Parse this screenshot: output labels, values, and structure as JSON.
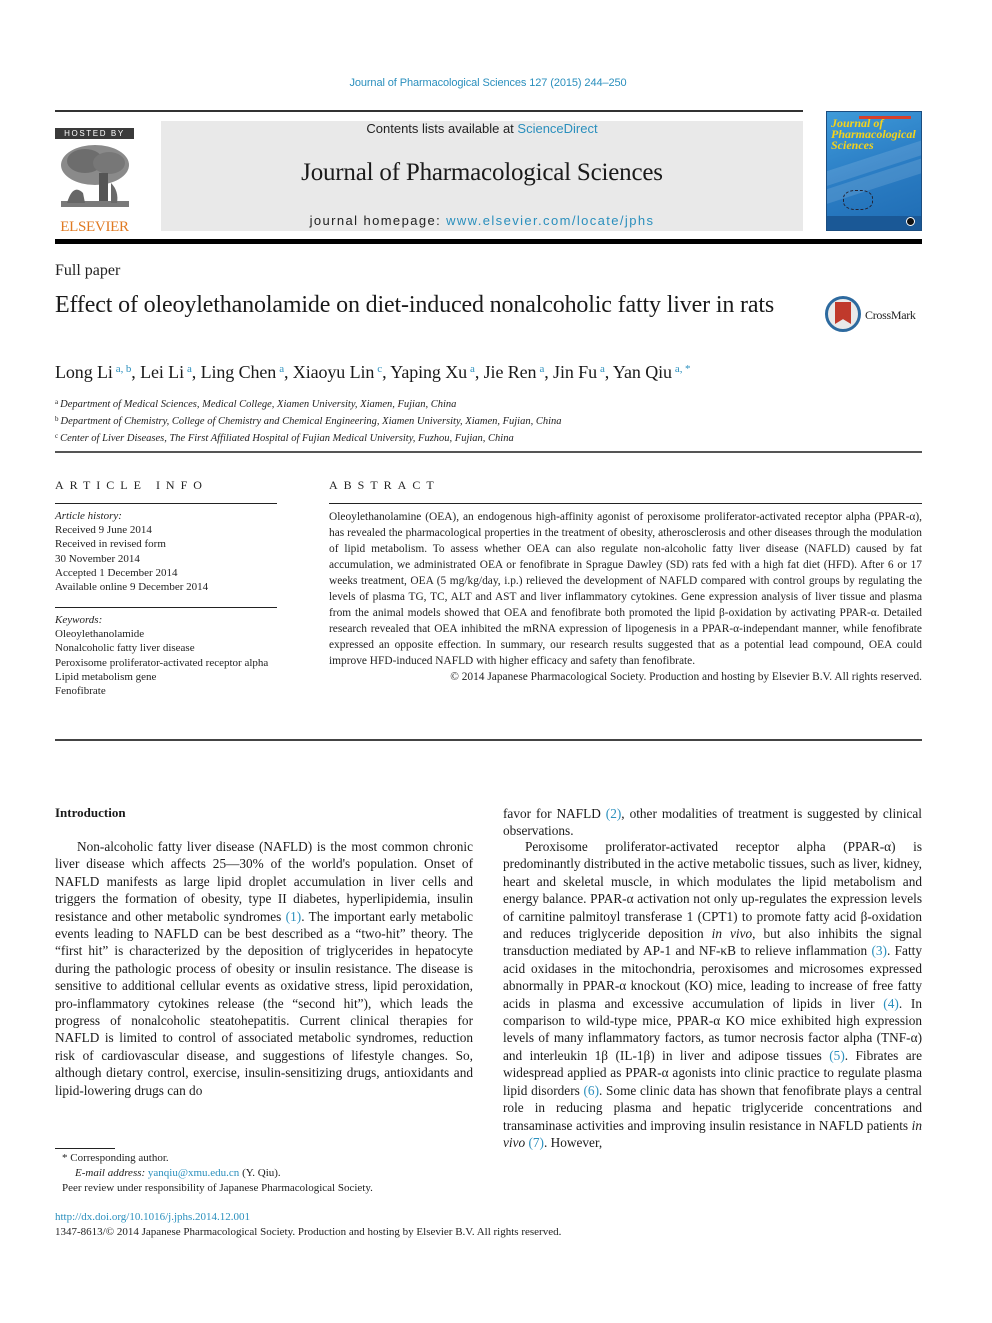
{
  "header": {
    "journal_citation": "Journal of Pharmacological Sciences 127 (2015) 244–250",
    "hosted_by": "HOSTED BY",
    "publisher": "ELSEVIER",
    "contents_prefix": "Contents lists available at ",
    "contents_link": "ScienceDirect",
    "journal_name": "Journal of Pharmacological Sciences",
    "homepage_prefix": "journal homepage: ",
    "homepage_link": "www.elsevier.com/locate/jphs",
    "cover_title": "Journal of Pharmacological Sciences"
  },
  "article": {
    "type": "Full paper",
    "title": "Effect of oleoylethanolamide on diet-induced nonalcoholic fatty liver in rats",
    "crossmark_label": "CrossMark",
    "authors": [
      {
        "name": "Long Li",
        "sup": "a, b",
        "sep": ", "
      },
      {
        "name": "Lei Li",
        "sup": "a",
        "sep": ", "
      },
      {
        "name": "Ling Chen",
        "sup": "a",
        "sep": ", "
      },
      {
        "name": "Xiaoyu Lin",
        "sup": "c",
        "sep": ", "
      },
      {
        "name": "Yaping Xu",
        "sup": "a",
        "sep": ", "
      },
      {
        "name": "Jie Ren",
        "sup": "a",
        "sep": ", "
      },
      {
        "name": "Jin Fu",
        "sup": "a",
        "sep": ", "
      },
      {
        "name": "Yan Qiu",
        "sup": "a, *",
        "sep": ""
      }
    ],
    "affiliations": [
      {
        "key": "a",
        "text": "Department of Medical Sciences, Medical College, Xiamen University, Xiamen, Fujian, China"
      },
      {
        "key": "b",
        "text": "Department of Chemistry, College of Chemistry and Chemical Engineering, Xiamen University, Xiamen, Fujian, China"
      },
      {
        "key": "c",
        "text": "Center of Liver Diseases, The First Affiliated Hospital of Fujian Medical University, Fuzhou, Fujian, China"
      }
    ]
  },
  "article_info": {
    "heading": "ARTICLE INFO",
    "history_label": "Article history:",
    "history": [
      "Received 9 June 2014",
      "Received in revised form",
      "30 November 2014",
      "Accepted 1 December 2014",
      "Available online 9 December 2014"
    ],
    "keywords_label": "Keywords:",
    "keywords": [
      "Oleoylethanolamide",
      "Nonalcoholic fatty liver disease",
      "Peroxisome proliferator-activated receptor alpha",
      "Lipid metabolism gene",
      "Fenofibrate"
    ]
  },
  "abstract": {
    "heading": "ABSTRACT",
    "text": "Oleoylethanolamine (OEA), an endogenous high-affinity agonist of peroxisome proliferator-activated receptor alpha (PPAR-α), has revealed the pharmacological properties in the treatment of obesity, atherosclerosis and other diseases through the modulation of lipid metabolism. To assess whether OEA can also regulate non-alcoholic fatty liver disease (NAFLD) caused by fat accumulation, we administrated OEA or fenofibrate in Sprague Dawley (SD) rats fed with a high fat diet (HFD). After 6 or 17 weeks treatment, OEA (5 mg/kg/day, i.p.) relieved the development of NAFLD compared with control groups by regulating the levels of plasma TG, TC, ALT and AST and liver inflammatory cytokines. Gene expression analysis of liver tissue and plasma from the animal models showed that OEA and fenofibrate both promoted the lipid β-oxidation by activating PPAR-α. Detailed research revealed that OEA inhibited the mRNA expression of lipogenesis in a PPAR-α-independant manner, while fenofibrate expressed an opposite effection. In summary, our research results suggested that as a potential lead compound, OEA could improve HFD-induced NAFLD with higher efficacy and safety than fenofibrate.",
    "copyright": "© 2014 Japanese Pharmacological Society. Production and hosting by Elsevier B.V. All rights reserved."
  },
  "introduction": {
    "heading": "Introduction",
    "col_a": [
      {
        "t": "Non-alcoholic fatty liver disease (NAFLD) is the most common chronic liver disease which affects 25—30% of the world's population. Onset of NAFLD manifests as large lipid droplet accumulation in liver cells and triggers the formation of obesity, type II diabetes, hyperlipidemia, insulin resistance and other metabolic syndromes "
      },
      {
        "ref": "(1)"
      },
      {
        "t": ". The important early metabolic events leading to NAFLD can be best described as a “two-hit” theory. The “first hit” is characterized by the deposition of triglycerides in hepatocyte during the pathologic process of obesity or insulin resistance. The disease is sensitive to additional cellular events as oxidative stress, lipid peroxidation, pro-inflammatory cytokines release (the “second hit”), which leads the progress of nonalcoholic steatohepatitis. Current clinical therapies for NAFLD is limited to control of associated metabolic syndromes, reduction risk of cardiovascular disease, and suggestions of lifestyle changes. So, although dietary control, exercise, insulin-sensitizing drugs, antioxidants and lipid-lowering drugs can do"
      }
    ],
    "col_b1": [
      {
        "t": "favor for NAFLD "
      },
      {
        "ref": "(2)"
      },
      {
        "t": ", other modalities of treatment is suggested by clinical observations."
      }
    ],
    "col_b2": [
      {
        "t": "Peroxisome proliferator-activated receptor alpha (PPAR-α) is predominantly distributed in the active metabolic tissues, such as liver, kidney, heart and skeletal muscle, in which modulates the lipid metabolism and energy balance. PPAR-α activation not only up-regulates the expression levels of carnitine palmitoyl transferase 1 (CPT1) to promote fatty acid β-oxidation and reduces triglyceride deposition "
      },
      {
        "i": "in vivo"
      },
      {
        "t": ", but also inhibits the signal transduction mediated by AP-1 and NF-κB to relieve inflammation "
      },
      {
        "ref": "(3)"
      },
      {
        "t": ". Fatty acid oxidases in the mitochondria, peroxisomes and microsomes expressed abnormally in PPAR-α knockout (KO) mice, leading to increase of free fatty acids in plasma and excessive accumulation of lipids in liver "
      },
      {
        "ref": "(4)"
      },
      {
        "t": ". In comparison to wild-type mice, PPAR-α KO mice exhibited high expression levels of many inflammatory factors, as tumor necrosis factor alpha (TNF-α) and interleukin 1β (IL-1β) in liver and adipose tissues "
      },
      {
        "ref": "(5)"
      },
      {
        "t": ". Fibrates are widespread applied as PPAR-α agonists into clinic practice to regulate plasma lipid disorders "
      },
      {
        "ref": "(6)"
      },
      {
        "t": ". Some clinic data has shown that fenofibrate plays a central role in reducing plasma and hepatic triglyceride concentrations and transaminase activities and improving insulin resistance in NAFLD patients "
      },
      {
        "i": "in vivo"
      },
      {
        "t": " "
      },
      {
        "ref": "(7)"
      },
      {
        "t": ". However,"
      }
    ]
  },
  "footnotes": {
    "corresponding": "* Corresponding author.",
    "email_label": "E-mail address: ",
    "email": "yanqiu@xmu.edu.cn",
    "email_suffix": " (Y. Qiu).",
    "peer_review": "Peer review under responsibility of Japanese Pharmacological Society."
  },
  "footer": {
    "doi": "http://dx.doi.org/10.1016/j.jphs.2014.12.001",
    "issn_copyright": "1347-8613/© 2014 Japanese Pharmacological Society. Production and hosting by Elsevier B.V. All rights reserved."
  },
  "colors": {
    "link": "#2a8fbd",
    "elsevier_orange": "#e07a22",
    "masthead_bg": "#e9e9e9",
    "cover_blue": "#2c7fc6",
    "crossmark_red": "#c0392b"
  }
}
